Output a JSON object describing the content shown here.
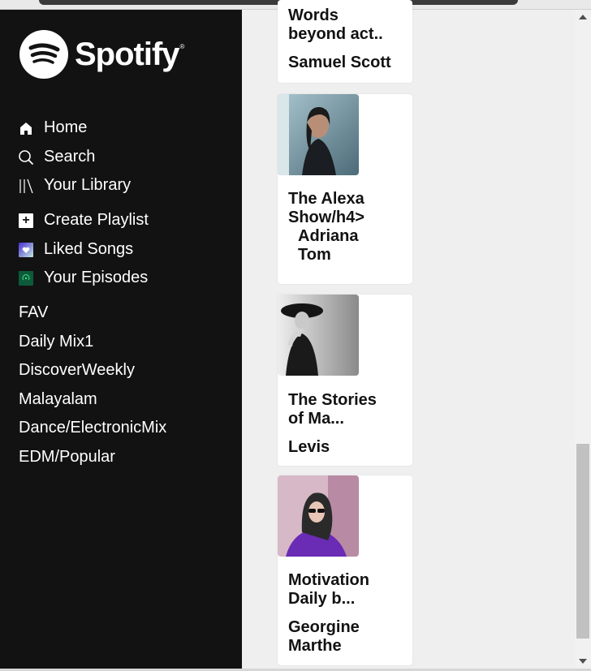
{
  "app": {
    "name": "Spotify"
  },
  "nav": {
    "home": "Home",
    "search": "Search",
    "library": "Your Library",
    "create_playlist": "Create Playlist",
    "liked_songs": "Liked Songs",
    "your_episodes": "Your Episodes"
  },
  "playlists": [
    "FAV",
    "Daily Mix1",
    "DiscoverWeekly",
    "Malayalam",
    "Dance/ElectronicMix",
    "EDM/Popular"
  ],
  "cards": [
    {
      "title": "Words beyond act..",
      "author": "Samuel Scott"
    },
    {
      "title": "The Alexa Show/h4>",
      "author": "Adriana Tom"
    },
    {
      "title": "The Stories of Ma...",
      "author": "Levis"
    },
    {
      "title": "Motivation Daily b...",
      "author": "Georgine Marthe"
    }
  ],
  "colors": {
    "sidebar_bg": "#121212",
    "content_bg": "#efefef",
    "card_bg": "#ffffff",
    "text_dark": "#121212"
  },
  "icons": {
    "home": "home-icon",
    "search": "search-icon",
    "library": "library-icon",
    "create_playlist": "plus-square-icon",
    "liked_songs": "heart-square-icon",
    "your_episodes": "podcast-square-icon"
  }
}
